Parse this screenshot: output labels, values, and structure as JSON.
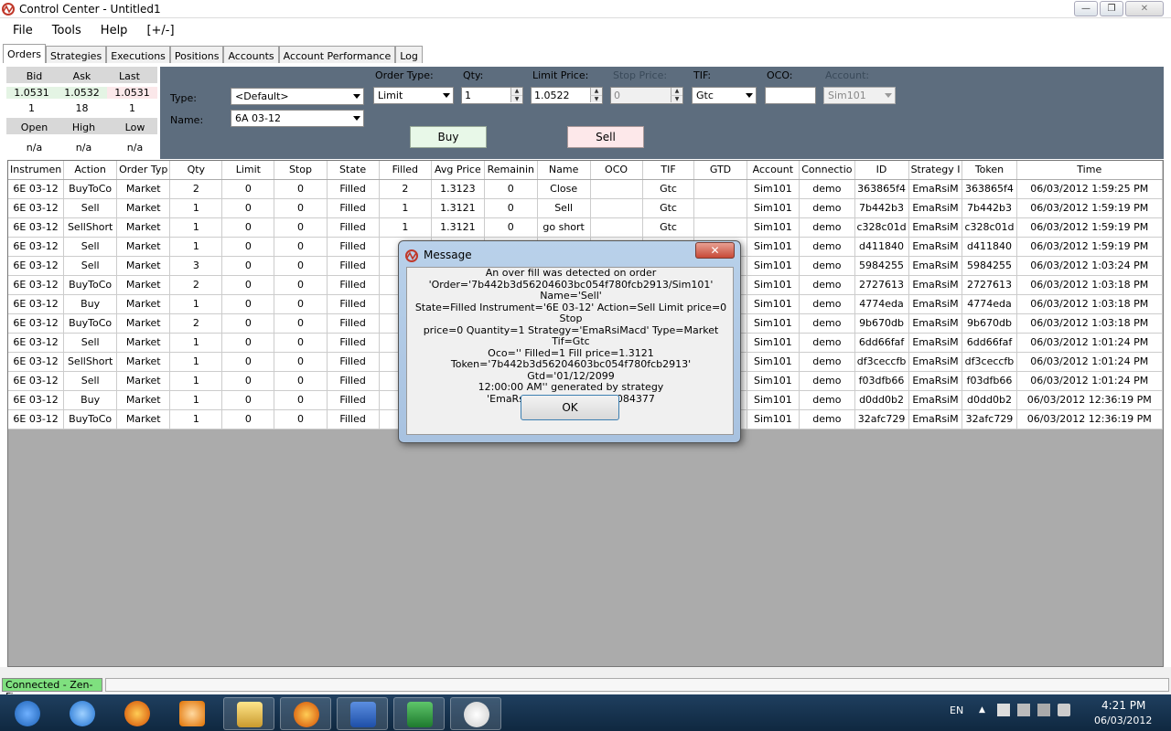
{
  "window": {
    "title": "Control Center - Untitled1",
    "minimize": "—",
    "maximize": "❐",
    "close": "✕"
  },
  "menu": [
    "File",
    "Tools",
    "Help",
    "[+/-]"
  ],
  "tabs": [
    "Orders",
    "Strategies",
    "Executions",
    "Positions",
    "Accounts",
    "Account Performance",
    "Log"
  ],
  "quote": {
    "headers1": [
      "Bid",
      "Ask",
      "Last"
    ],
    "prices": [
      "1.0531",
      "1.0532",
      "1.0531"
    ],
    "sizes": [
      "1",
      "18",
      "1"
    ],
    "headers2": [
      "Open",
      "High",
      "Low"
    ],
    "values2": [
      "n/a",
      "n/a",
      "n/a"
    ]
  },
  "order_entry": {
    "type_label": "Type:",
    "type_value": "<Default>",
    "name_label": "Name:",
    "name_value": "6A 03-12",
    "order_type_label": "Order Type:",
    "order_type_value": "Limit",
    "qty_label": "Qty:",
    "qty_value": "1",
    "limit_price_label": "Limit Price:",
    "limit_price_value": "1.0522",
    "stop_price_label": "Stop Price:",
    "stop_price_value": "0",
    "tif_label": "TIF:",
    "tif_value": "Gtc",
    "oco_label": "OCO:",
    "oco_value": "",
    "account_label": "Account:",
    "account_value": "Sim101",
    "buy_label": "Buy",
    "sell_label": "Sell"
  },
  "grid": {
    "columns": [
      "Instrumen",
      "Action",
      "Order Typ",
      "Qty",
      "Limit",
      "Stop",
      "State",
      "Filled",
      "Avg Price",
      "Remainin",
      "Name",
      "OCO",
      "TIF",
      "GTD",
      "Account",
      "Connectio",
      "ID",
      "Strategy I",
      "Token",
      "Time"
    ],
    "rows": [
      [
        "6E 03-12",
        "BuyToCo",
        "Market",
        "2",
        "0",
        "0",
        "Filled",
        "2",
        "1.3123",
        "0",
        "Close",
        "",
        "Gtc",
        "",
        "Sim101",
        "demo",
        "363865f4",
        "EmaRsiM",
        "363865f4",
        "06/03/2012 1:59:25 PM"
      ],
      [
        "6E 03-12",
        "Sell",
        "Market",
        "1",
        "0",
        "0",
        "Filled",
        "1",
        "1.3121",
        "0",
        "Sell",
        "",
        "Gtc",
        "",
        "Sim101",
        "demo",
        "7b442b3",
        "EmaRsiM",
        "7b442b3",
        "06/03/2012 1:59:19 PM"
      ],
      [
        "6E 03-12",
        "SellShort",
        "Market",
        "1",
        "0",
        "0",
        "Filled",
        "1",
        "1.3121",
        "0",
        "go short",
        "",
        "Gtc",
        "",
        "Sim101",
        "demo",
        "c328c01d",
        "EmaRsiM",
        "c328c01d",
        "06/03/2012 1:59:19 PM"
      ],
      [
        "6E 03-12",
        "Sell",
        "Market",
        "1",
        "0",
        "0",
        "Filled",
        "",
        "",
        "",
        "",
        "",
        "",
        "",
        "Sim101",
        "demo",
        "d411840",
        "EmaRsiM",
        "d411840",
        "06/03/2012 1:59:19 PM"
      ],
      [
        "6E 03-12",
        "Sell",
        "Market",
        "3",
        "0",
        "0",
        "Filled",
        "",
        "",
        "",
        "",
        "",
        "",
        "",
        "Sim101",
        "demo",
        "5984255",
        "EmaRsiM",
        "5984255",
        "06/03/2012 1:03:24 PM"
      ],
      [
        "6E 03-12",
        "BuyToCo",
        "Market",
        "2",
        "0",
        "0",
        "Filled",
        "",
        "",
        "",
        "",
        "",
        "",
        "",
        "Sim101",
        "demo",
        "2727613",
        "EmaRsiM",
        "2727613",
        "06/03/2012 1:03:18 PM"
      ],
      [
        "6E 03-12",
        "Buy",
        "Market",
        "1",
        "0",
        "0",
        "Filled",
        "",
        "",
        "",
        "",
        "",
        "",
        "",
        "Sim101",
        "demo",
        "4774eda",
        "EmaRsiM",
        "4774eda",
        "06/03/2012 1:03:18 PM"
      ],
      [
        "6E 03-12",
        "BuyToCo",
        "Market",
        "2",
        "0",
        "0",
        "Filled",
        "",
        "",
        "",
        "",
        "",
        "",
        "",
        "Sim101",
        "demo",
        "9b670db",
        "EmaRsiM",
        "9b670db",
        "06/03/2012 1:03:18 PM"
      ],
      [
        "6E 03-12",
        "Sell",
        "Market",
        "1",
        "0",
        "0",
        "Filled",
        "",
        "",
        "",
        "",
        "",
        "",
        "",
        "Sim101",
        "demo",
        "6dd66faf",
        "EmaRsiM",
        "6dd66faf",
        "06/03/2012 1:01:24 PM"
      ],
      [
        "6E 03-12",
        "SellShort",
        "Market",
        "1",
        "0",
        "0",
        "Filled",
        "",
        "",
        "",
        "",
        "",
        "",
        "",
        "Sim101",
        "demo",
        "df3ceccfb",
        "EmaRsiM",
        "df3ceccfb",
        "06/03/2012 1:01:24 PM"
      ],
      [
        "6E 03-12",
        "Sell",
        "Market",
        "1",
        "0",
        "0",
        "Filled",
        "",
        "",
        "",
        "",
        "",
        "",
        "",
        "Sim101",
        "demo",
        "f03dfb66",
        "EmaRsiM",
        "f03dfb66",
        "06/03/2012 1:01:24 PM"
      ],
      [
        "6E 03-12",
        "Buy",
        "Market",
        "1",
        "0",
        "0",
        "Filled",
        "",
        "",
        "",
        "",
        "",
        "",
        "",
        "Sim101",
        "demo",
        "d0dd0b2",
        "EmaRsiM",
        "d0dd0b2",
        "06/03/2012 12:36:19 PM"
      ],
      [
        "6E 03-12",
        "BuyToCo",
        "Market",
        "1",
        "0",
        "0",
        "Filled",
        "",
        "",
        "",
        "",
        "",
        "",
        "",
        "Sim101",
        "demo",
        "32afc729",
        "EmaRsiM",
        "32afc729",
        "06/03/2012 12:36:19 PM"
      ]
    ]
  },
  "status": {
    "connection": "Connected - Zen-Fire"
  },
  "dialog": {
    "title": "Message",
    "close": "✕",
    "lines": [
      "An over fill was detected on order",
      "'Order='7b442b3d56204603bc054f780fcb2913/Sim101' Name='Sell'",
      "State=Filled Instrument='6E 03-12' Action=Sell Limit price=0 Stop",
      "price=0 Quantity=1 Strategy='EmaRsiMacd' Type=Market Tif=Gtc",
      "Oco='' Filled=1 Fill price=1.3121",
      "Token='7b442b3d56204603bc054f780fcb2913' Gtd='01/12/2099",
      "12:00:00 AM'' generated by strategy 'EmaRsiMacd/4ccf7bb436084377"
    ],
    "ok": "OK"
  },
  "taskbar": {
    "lang": "EN",
    "time": "4:21 PM",
    "date": "06/03/2012"
  },
  "colors": {
    "order_panel": "#5d6d7e",
    "connected": "#7fe07f",
    "buy": "#e8f8e8",
    "sell": "#fde8ea"
  }
}
